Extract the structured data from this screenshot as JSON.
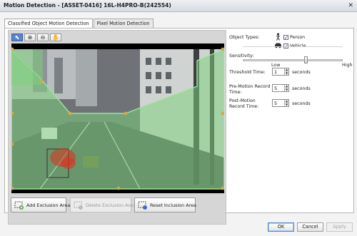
{
  "window": {
    "title": "Motion Detection - [ASSET-0416] 16L-H4PRO-B(242554)",
    "close_glyph": "✕"
  },
  "tabs": [
    {
      "label": "Classified Object Motion Detection",
      "active": true
    },
    {
      "label": "Pixel Motion Detection",
      "active": false
    }
  ],
  "toolbar": {
    "tools": [
      {
        "icon": "pointer-icon",
        "glyph": "⬉",
        "active": true
      },
      {
        "icon": "zoom-in-icon",
        "glyph": "⊕",
        "active": false
      },
      {
        "icon": "zoom-out-icon",
        "glyph": "⊖",
        "active": false
      },
      {
        "icon": "pan-hand-icon",
        "glyph": "✋",
        "active": false
      }
    ]
  },
  "bottom_buttons": {
    "add_exclusion": "Add Exclusion Area",
    "delete_exclusion": "Delete Exclusion Area",
    "reset_inclusion": "Reset Inclusion Area"
  },
  "settings": {
    "object_types_label": "Object Types:",
    "person_label": "Person",
    "person_checked": true,
    "vehicle_label": "Vehicle",
    "vehicle_checked": true,
    "sensitivity_label": "Sensitivity:",
    "sensitivity_low": "Low",
    "sensitivity_high": "High",
    "sensitivity_value_fraction": 0.64,
    "threshold_label": "Threshold Time:",
    "threshold_value": "1",
    "threshold_unit": "seconds",
    "pre_motion_label_line1": "Pre-Motion Record",
    "pre_motion_label_line2": "Time:",
    "pre_motion_value": "5",
    "pre_motion_unit": "seconds",
    "post_motion_label_line1": "Post-Motion",
    "post_motion_label_line2": "Record Time:",
    "post_motion_value": "5",
    "post_motion_unit": "seconds"
  },
  "footer": {
    "ok": "OK",
    "cancel": "Cancel",
    "apply": "Apply"
  },
  "colors": {
    "inclusion_overlay": "#7cd17a",
    "handle": "#d2a94a",
    "motion_heat": "#e0301e",
    "active_tool": "#5a84c9"
  }
}
